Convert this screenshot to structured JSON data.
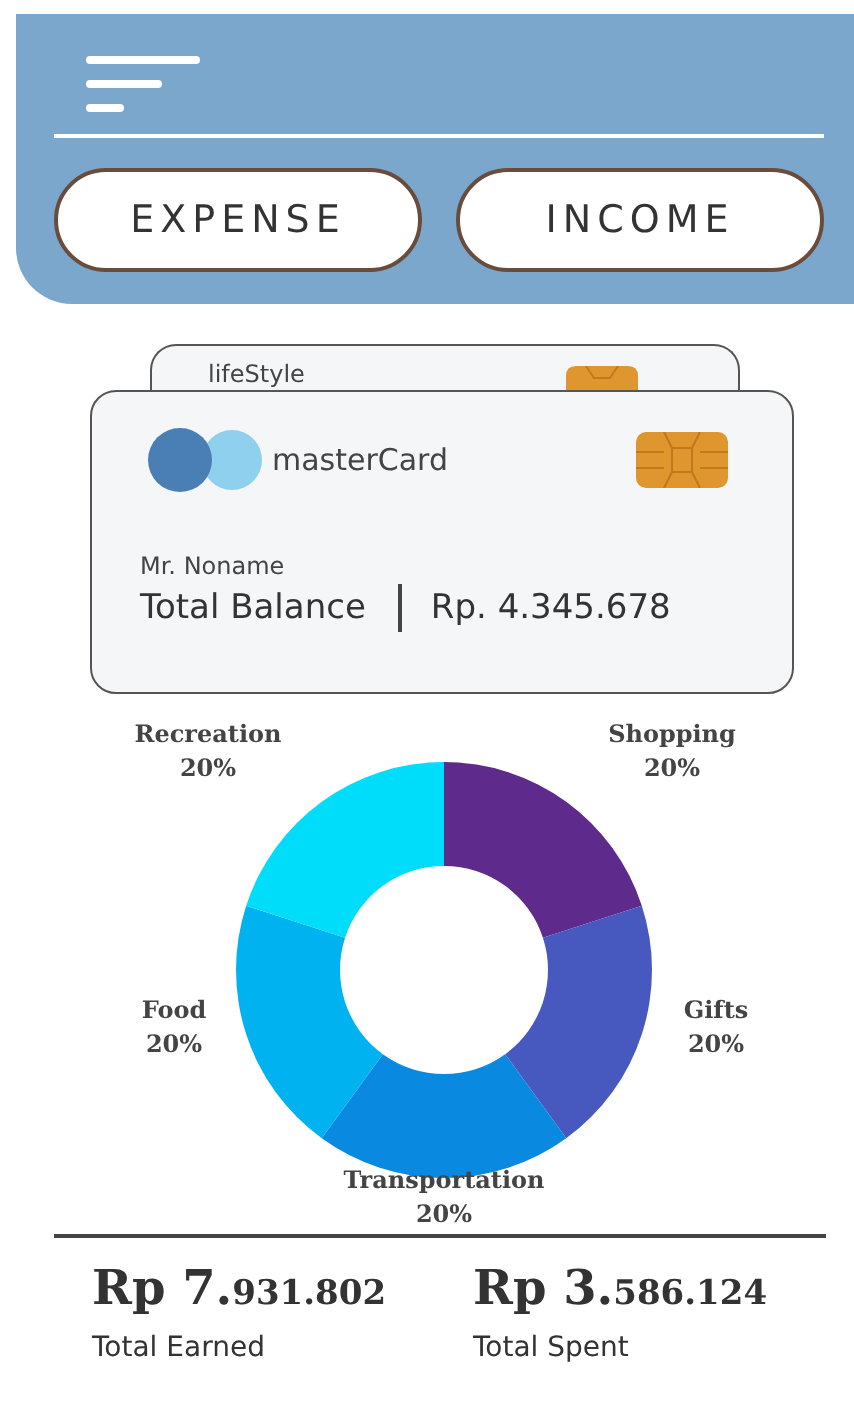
{
  "header": {
    "buttons": [
      {
        "label": "EXPENSE"
      },
      {
        "label": "INCOME"
      }
    ]
  },
  "cards": [
    {
      "name": "lifeStyle"
    },
    {
      "brand": "masterCard",
      "holder": "Mr. Noname",
      "balance_label": "Total Balance",
      "balance": "Rp. 4.345.678"
    }
  ],
  "chart": {
    "chart_data": {
      "type": "donut",
      "categories": [
        "Shopping",
        "Gifts",
        "Transportation",
        "Food",
        "Recreation"
      ],
      "values": [
        20,
        20,
        20,
        20,
        20
      ],
      "value_labels": [
        "20%",
        "20%",
        "20%",
        "20%",
        "20%"
      ]
    }
  },
  "totals": [
    {
      "major": "Rp 7.",
      "minor": "931.802",
      "label": "Total Earned"
    },
    {
      "major": "Rp 3.",
      "minor": "586.124",
      "label": "Total Spent"
    }
  ]
}
